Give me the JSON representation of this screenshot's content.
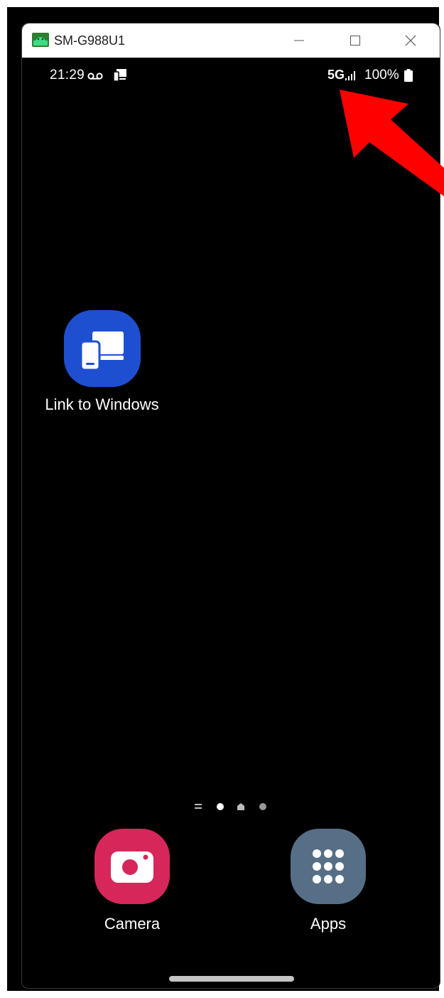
{
  "window": {
    "title": "SM-G988U1",
    "app_icon": "android-icon",
    "controls": [
      "minimize-icon",
      "maximize-icon",
      "close-icon"
    ]
  },
  "status_bar": {
    "time": "21:29",
    "left_icons": [
      "voicemail-icon",
      "screen-mirror-icon"
    ],
    "network": "5G",
    "signal_icon": "signal-bars-icon",
    "battery_percent": "100%",
    "battery_icon": "battery-icon"
  },
  "home_screen": {
    "apps": [
      {
        "label": "Link to Windows",
        "icon": "link-to-windows-icon",
        "color": "#1f4fd1"
      }
    ],
    "page_indicator": {
      "pages": [
        "menu",
        "dot",
        "home",
        "dot"
      ],
      "active_index": 1
    }
  },
  "dock": {
    "apps": [
      {
        "label": "Camera",
        "icon": "camera-icon",
        "color": "#d7265a"
      },
      {
        "label": "Apps",
        "icon": "app-grid-icon",
        "color": "#566f86"
      }
    ]
  },
  "annotation": {
    "type": "arrow",
    "color": "#ff0000",
    "points_to": "network-indicator"
  }
}
